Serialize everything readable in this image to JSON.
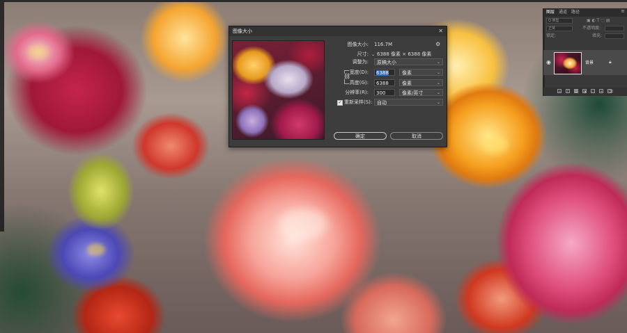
{
  "dialog": {
    "title": "图像大小",
    "close_label": "✕",
    "image_size_label": "图像大小:",
    "image_size_value": "116.7M",
    "dimensions_label": "尺寸:",
    "dimensions_value": "6388 像素 × 6388 像素",
    "fit_to_label": "调整为:",
    "fit_to_value": "原稿大小",
    "width_label": "宽度(D):",
    "width_value": "6388",
    "width_unit": "像素",
    "height_label": "高度(G):",
    "height_value": "6388",
    "height_unit": "像素",
    "resolution_label": "分辨率(R):",
    "resolution_value": "300",
    "resolution_unit": "像素/英寸",
    "resample_label": "重新采样(S):",
    "resample_checked": true,
    "resample_value": "自动",
    "ok_label": "确定",
    "cancel_label": "取消"
  },
  "layers_panel": {
    "tabs": [
      "图层",
      "通道",
      "路径"
    ],
    "filter_placeholder": "Q 类型",
    "blend_mode": "正常",
    "opacity_label": "不透明度:",
    "fill_label": "填充:",
    "lock_label": "锁定:",
    "layer_name": "背景",
    "icons": [
      "eye-icon",
      "lock-icon",
      "link-icon",
      "fx-icon",
      "mask-icon",
      "adjustment-icon",
      "folder-icon",
      "new-layer-icon",
      "trash-icon"
    ]
  }
}
